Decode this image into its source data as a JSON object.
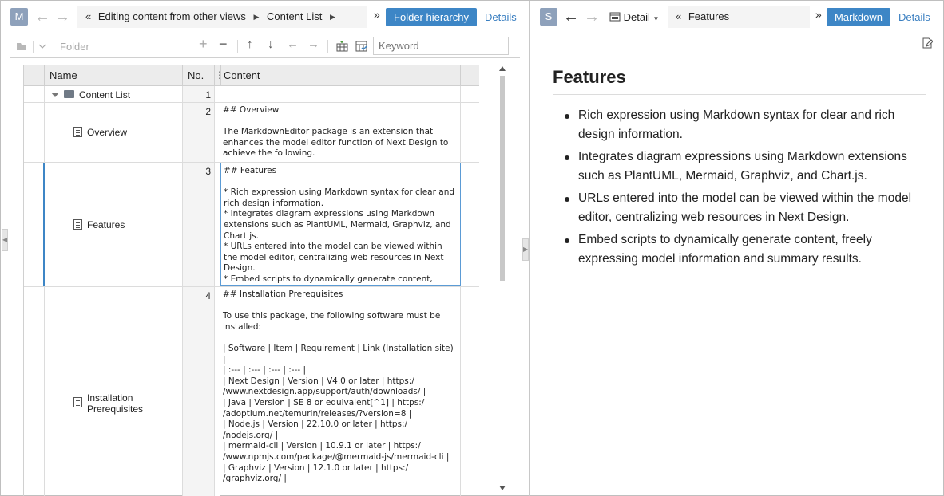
{
  "left": {
    "badge": "M",
    "breadcrumb": [
      "Editing content from other views",
      "Content List"
    ],
    "primary_button": "Folder hierarchy",
    "details_link": "Details",
    "toolbar": {
      "folder_placeholder": "Folder",
      "keyword_placeholder": "Keyword"
    },
    "columns": {
      "name": "Name",
      "no": "No.",
      "content": "Content"
    },
    "rows": [
      {
        "name": "Content List",
        "no": "1",
        "content": ""
      },
      {
        "name": "Overview",
        "no": "2",
        "content": "## Overview\n\nThe MarkdownEditor package is an extension that enhances the model editor function of Next Design to achieve the following."
      },
      {
        "name": "Features",
        "no": "3",
        "content": "## Features\n\n* Rich expression using Markdown syntax for clear and rich design information.\n* Integrates diagram expressions using Markdown extensions such as PlantUML, Mermaid, Graphviz, and Chart.js.\n* URLs entered into the model can be viewed within the model editor, centralizing web resources in Next Design.\n* Embed scripts to dynamically generate content, freely expressing model information and summary results."
      },
      {
        "name": "Installation Prerequisites",
        "no": "4",
        "content": "## Installation Prerequisites\n\nTo use this package, the following software must be installed:\n\n| Software | Item | Requirement | Link (Installation site) |\n| :--- | :--- | :--- | :--- |\n| Next Design | Version | V4.0 or later | https:/ /www.nextdesign.app/support/auth/downloads/ |\n| Java | Version | SE 8 or equivalent[^1] | https:/ /adoptium.net/temurin/releases/?version=8 |\n| Node.js | Version | 22.10.0 or later | https:/ /nodejs.org/ |\n| mermaid-cli | Version | 10.9.1 or later | https:/ /www.npmjs.com/package/@mermaid-js/mermaid-cli |\n| Graphviz | Version | 12.1.0 or later | https:/ /graphviz.org/ |"
      }
    ]
  },
  "right": {
    "badge": "S",
    "view_selector": "Detail",
    "breadcrumb": "Features",
    "primary_button": "Markdown",
    "details_link": "Details",
    "heading": "Features",
    "bullets": [
      "Rich expression using Markdown syntax for clear and rich design information.",
      "Integrates diagram expressions using Markdown extensions such as PlantUML, Mermaid, Graphviz, and Chart.js.",
      "URLs entered into the model can be viewed within the model editor, centralizing web resources in Next Design.",
      "Embed scripts to dynamically generate content, freely expressing model information and summary results."
    ]
  },
  "colors": {
    "accent": "#3d86c6",
    "link": "#3a7fc1",
    "badge": "#8ea1bb"
  }
}
